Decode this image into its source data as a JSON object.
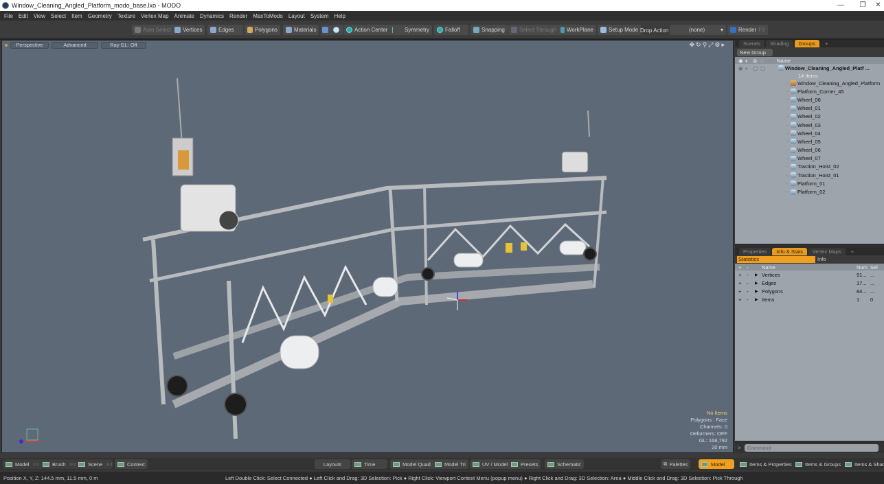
{
  "window": {
    "title": "Window_Cleaning_Angled_Platform_modo_base.lxo - MODO",
    "minimize": "—",
    "restore": "❐",
    "close": "✕"
  },
  "menu": [
    "File",
    "Edit",
    "View",
    "Select",
    "Item",
    "Geometry",
    "Texture",
    "Vertex Map",
    "Animate",
    "Dynamics",
    "Render",
    "MaxToModo",
    "Layout",
    "System",
    "Help"
  ],
  "toolbar": {
    "auto_select": "Auto Select",
    "vertices": "Vertices",
    "edges": "Edges",
    "polygons": "Polygons",
    "materials": "Materials",
    "action_center": "Action Center",
    "symmetry": "Symmetry",
    "falloff": "Falloff",
    "snapping": "Snapping",
    "select_through": "Select Through",
    "workplane": "WorkPlane",
    "setup_mode": "Setup Mode",
    "drop_action_label": "Drop Action",
    "drop_action_value": "(none)",
    "render": "Render",
    "render_key": "F9"
  },
  "viewport": {
    "view_mode": "Perspective",
    "advanced": "Advanced",
    "raygl": "Ray GL: Off",
    "info": {
      "items": "No Items",
      "polygons": "Polygons : Face",
      "channels": "Channels: 0",
      "deformers": "Deformers: OFF",
      "gl": "GL: 168,792",
      "scale": "20 mm"
    }
  },
  "groups_panel": {
    "tabs": [
      "Scenes",
      "Shading",
      "Groups"
    ],
    "active_tab": "Groups",
    "new_group": "New Group",
    "name_header": "Name",
    "root": {
      "name": "Window_Cleaning_Angled_Platf ...",
      "count": "14 Items"
    },
    "items": [
      "Window_Cleaning_Angled_Platform",
      "Platform_Corner_45",
      "Wheel_08",
      "Wheel_01",
      "Wheel_02",
      "Wheel_03",
      "Wheel_04",
      "Wheel_05",
      "Wheel_06",
      "Wheel_07",
      "Traction_Hoist_02",
      "Traction_Hoist_01",
      "Platform_01",
      "Platform_02"
    ]
  },
  "stats_panel": {
    "tabs": [
      "Properties",
      "Info & Stats",
      "Vertex Maps"
    ],
    "active_tab": "Info & Stats",
    "subtabs": [
      "Statistics",
      "Info"
    ],
    "headers": {
      "name": "Name",
      "num": "Num",
      "sel": "Sel"
    },
    "rows": [
      {
        "name": "Vertices",
        "num": "91...",
        "sel": "..."
      },
      {
        "name": "Edges",
        "num": "17...",
        "sel": "..."
      },
      {
        "name": "Polygons",
        "num": "84...",
        "sel": "..."
      },
      {
        "name": "Items",
        "num": "1",
        "sel": "0"
      }
    ]
  },
  "command": {
    "placeholder": "Command"
  },
  "bottom_bar": {
    "left": [
      {
        "label": "Model",
        "key": "F2"
      },
      {
        "label": "Brush",
        "key": "F3"
      },
      {
        "label": "Scene",
        "key": "F4"
      },
      {
        "label": "Context",
        "key": ""
      }
    ],
    "layouts": "Layouts",
    "time": "Time",
    "mid": [
      "Model Quad",
      "Model Tri",
      "UV / Model",
      "Presets",
      "Schematic"
    ],
    "palettes": "Palettes",
    "model": "Model",
    "right": [
      "Items & Properties",
      "Items & Groups",
      "Items & Shading"
    ]
  },
  "status": {
    "position": "Position X, Y, Z:   144.5 mm, 11.5 mm, 0 m",
    "hints": "Left Double Click: Select Connected ● Left Click and Drag: 3D Selection: Pick ● Right Click: Viewport Context Menu (popup menu) ● Right Click and Drag: 3D Selection: Area ● Middle Click and Drag: 3D Selection: Pick Through"
  }
}
